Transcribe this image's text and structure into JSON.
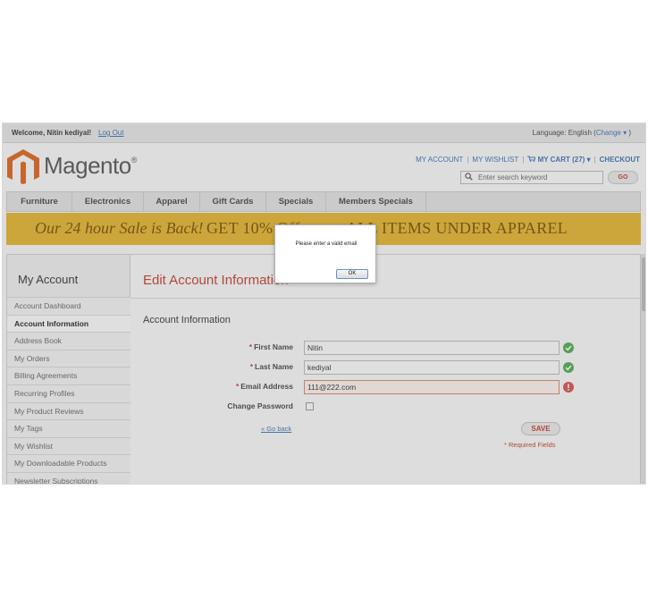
{
  "topbar": {
    "welcome": "Welcome, Nitin kediyal!",
    "logout": "Log Out",
    "language_prefix": "Language:  English (",
    "change": "Change",
    "change_arrow": "▾",
    "language_suffix": " )"
  },
  "header": {
    "logo_text": "Magento",
    "logo_mark": "®",
    "my_account": "MY ACCOUNT",
    "my_wishlist": "MY WISHLIST",
    "my_cart": "MY CART (27)",
    "cart_arrow": "▾",
    "checkout": "CHECKOUT",
    "search_placeholder": "Enter search keyword",
    "go_label": "GO"
  },
  "nav": {
    "items": [
      {
        "label": "Furniture"
      },
      {
        "label": "Electronics"
      },
      {
        "label": "Apparel"
      },
      {
        "label": "Gift Cards"
      },
      {
        "label": "Specials"
      },
      {
        "label": "Members Specials"
      }
    ]
  },
  "banner": {
    "part1": "Our 24 hour Sale is Back!",
    "part2": "GET 10% Off",
    "part3": "ALL ITEMS UNDER APPAREL"
  },
  "sidebar": {
    "title": "My Account",
    "items": [
      {
        "label": "Account Dashboard"
      },
      {
        "label": "Account Information"
      },
      {
        "label": "Address Book"
      },
      {
        "label": "My Orders"
      },
      {
        "label": "Billing Agreements"
      },
      {
        "label": "Recurring Profiles"
      },
      {
        "label": "My Product Reviews"
      },
      {
        "label": "My Tags"
      },
      {
        "label": "My Wishlist"
      },
      {
        "label": "My Downloadable Products"
      },
      {
        "label": "Newsletter Subscriptions"
      }
    ],
    "active_index": 1
  },
  "main": {
    "page_title": "Edit Account Information",
    "section_title": "Account Information",
    "fields": {
      "first_name": {
        "label": "First Name",
        "value": "Nitin",
        "required": "*"
      },
      "last_name": {
        "label": "Last Name",
        "value": "kediyal",
        "required": "*"
      },
      "email": {
        "label": "Email Address",
        "value": "111@222.com",
        "required": "*"
      },
      "change_password": {
        "label": "Change Password",
        "checked": false
      }
    },
    "back_link": "« Go back",
    "save_label": "SAVE",
    "required_note": "* Required Fields"
  },
  "dialog": {
    "message": "Please enter a valid email",
    "ok_label": "OK"
  },
  "colors": {
    "accent_red": "#c43d2c",
    "link_blue": "#3a72b8",
    "banner_yellow": "#e7b62d",
    "valid_green": "#4caf50",
    "error_red": "#d9534f"
  }
}
